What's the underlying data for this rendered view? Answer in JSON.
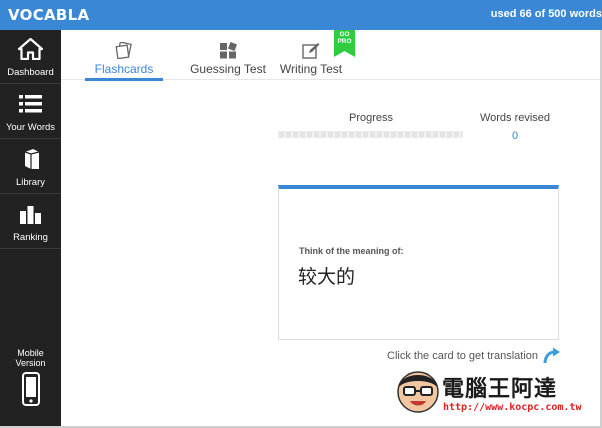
{
  "app": {
    "title": "VOCABLA",
    "usage": "used 66 of 500 words"
  },
  "sidebar": {
    "items": [
      {
        "label": "Dashboard",
        "icon": "home-icon"
      },
      {
        "label": "Your Words",
        "icon": "list-icon"
      },
      {
        "label": "Library",
        "icon": "books-icon"
      },
      {
        "label": "Ranking",
        "icon": "bar-chart-icon"
      }
    ],
    "mobile": {
      "line1": "Mobile",
      "line2": "Version",
      "icon": "phone-icon"
    }
  },
  "tabs": [
    {
      "label": "Flashcards",
      "icon": "flashcards-icon",
      "active": true
    },
    {
      "label": "Guessing Test",
      "icon": "tiles-icon",
      "active": false
    },
    {
      "label": "Writing Test",
      "icon": "pencil-icon",
      "active": false,
      "badge": [
        "GO",
        "PRO"
      ]
    }
  ],
  "stats": {
    "progress_label": "Progress",
    "progress_value": 0,
    "revised_label": "Words revised",
    "revised_count": "0"
  },
  "card": {
    "prompt": "Think of the meaning of:",
    "word": "较大的"
  },
  "hint": "Click the card to get translation",
  "watermark": {
    "title": "電腦王阿達",
    "url": "http://www.kocpc.com.tw"
  },
  "colors": {
    "accent": "#3a87d6",
    "sidebar": "#222222",
    "ribbon": "#2ecc40"
  }
}
